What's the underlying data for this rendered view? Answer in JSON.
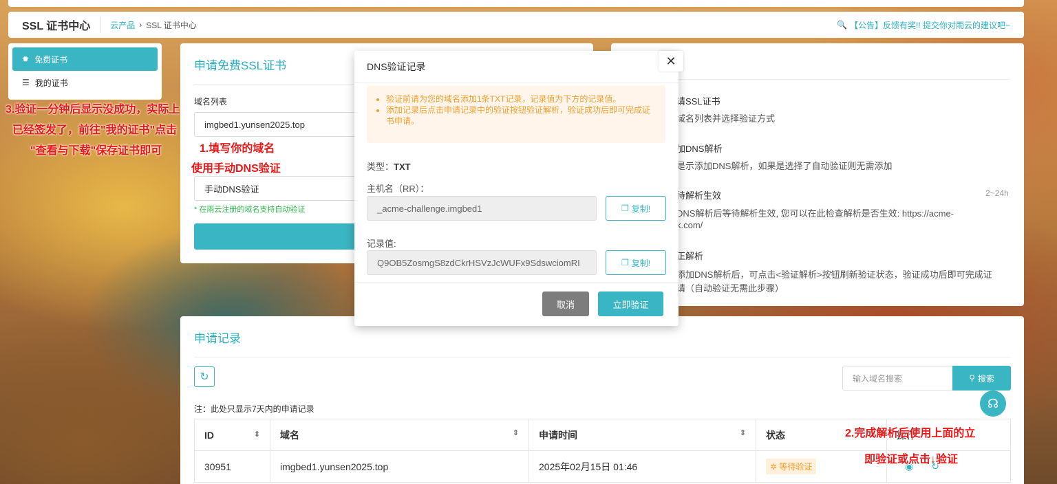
{
  "header": {
    "brand": "SSL 证书中心",
    "crumb_link": "云产品",
    "crumb_sep": "›",
    "crumb_current": "SSL 证书中心",
    "notice": "【公告】反馈有奖!! 提交你对雨云的建议吧~"
  },
  "sidebar": {
    "items": [
      {
        "label": "免费证书",
        "active": true
      },
      {
        "label": "我的证书",
        "active": false
      }
    ]
  },
  "apply": {
    "title": "申请免费SSL证书",
    "domain_label": "域名列表",
    "domain_value": "imgbed1.yunsen2025.top",
    "method_value": "手动DNS验证",
    "hint": "* 在雨云注册的域名支持自动验证"
  },
  "guide": {
    "l1": "请SSL证书",
    "l1sub": "域名列表并选择验证方式",
    "l2": "加DNS解析",
    "l2sub": "是示添加DNS解析，如果是选择了自动验证则无需添加",
    "l3": "待解析生效",
    "l3time": "2~24h",
    "l3sub": "DNS解析后等待解析生效, 您可以在此检查解析是否生效: https://acme-",
    "l3sub2": "k.com/",
    "l4": "正解析",
    "l4sub": "添加DNS解析后，可点击<验证解析>按钮刷新验证状态，验证成功后即可完成证",
    "l4sub2": "请（自动验证无需此步骤）"
  },
  "records": {
    "title": "申请记录",
    "search_placeholder": "输入域名搜索",
    "search_label": "搜索",
    "note": "注：此处只显示7天内的申请记录",
    "columns": [
      "ID",
      "域名",
      "申请时间",
      "状态",
      "操作"
    ],
    "rows": [
      {
        "id": "30951",
        "domain": "imgbed1.yunsen2025.top",
        "time": "2025年02月15日 01:46",
        "status": "等待验证"
      }
    ]
  },
  "modal": {
    "title": "DNS验证记录",
    "close": "✕",
    "alerts": [
      "验证前请为您的域名添加1条TXT记录，记录值为下方的记录值。",
      "添加记录后点击申请记录中的验证按钮验证解析，验证成功后即可完成证书申请。"
    ],
    "type_label": "类型：",
    "type_value": "TXT",
    "host_label": "主机名（RR）：",
    "host_value": "_acme-challenge.imgbed1",
    "value_label": "记录值:",
    "value_value": "Q9OB5ZosmgS8zdCkrHSVzJcWUFx9SdswciomRI",
    "copy_label": "复制!",
    "cancel": "取消",
    "verify": "立即验证"
  },
  "annotations": {
    "a1": "1.填写你的域名",
    "a1b": "使用手动DNS验证",
    "a2": "2.完成解析后使用上面的立",
    "a2b": "即验证或点击↓验证",
    "a3": "3.验证一分钟后显示没成功，实际上",
    "a3b": "已经签发了，前往\"我的证书\"点击",
    "a3c": "\"查看与下载\"保存证书即可"
  },
  "colors": {
    "accent": "#3ab5c4",
    "warning": "#f0a030",
    "annotation": "#e81818"
  }
}
